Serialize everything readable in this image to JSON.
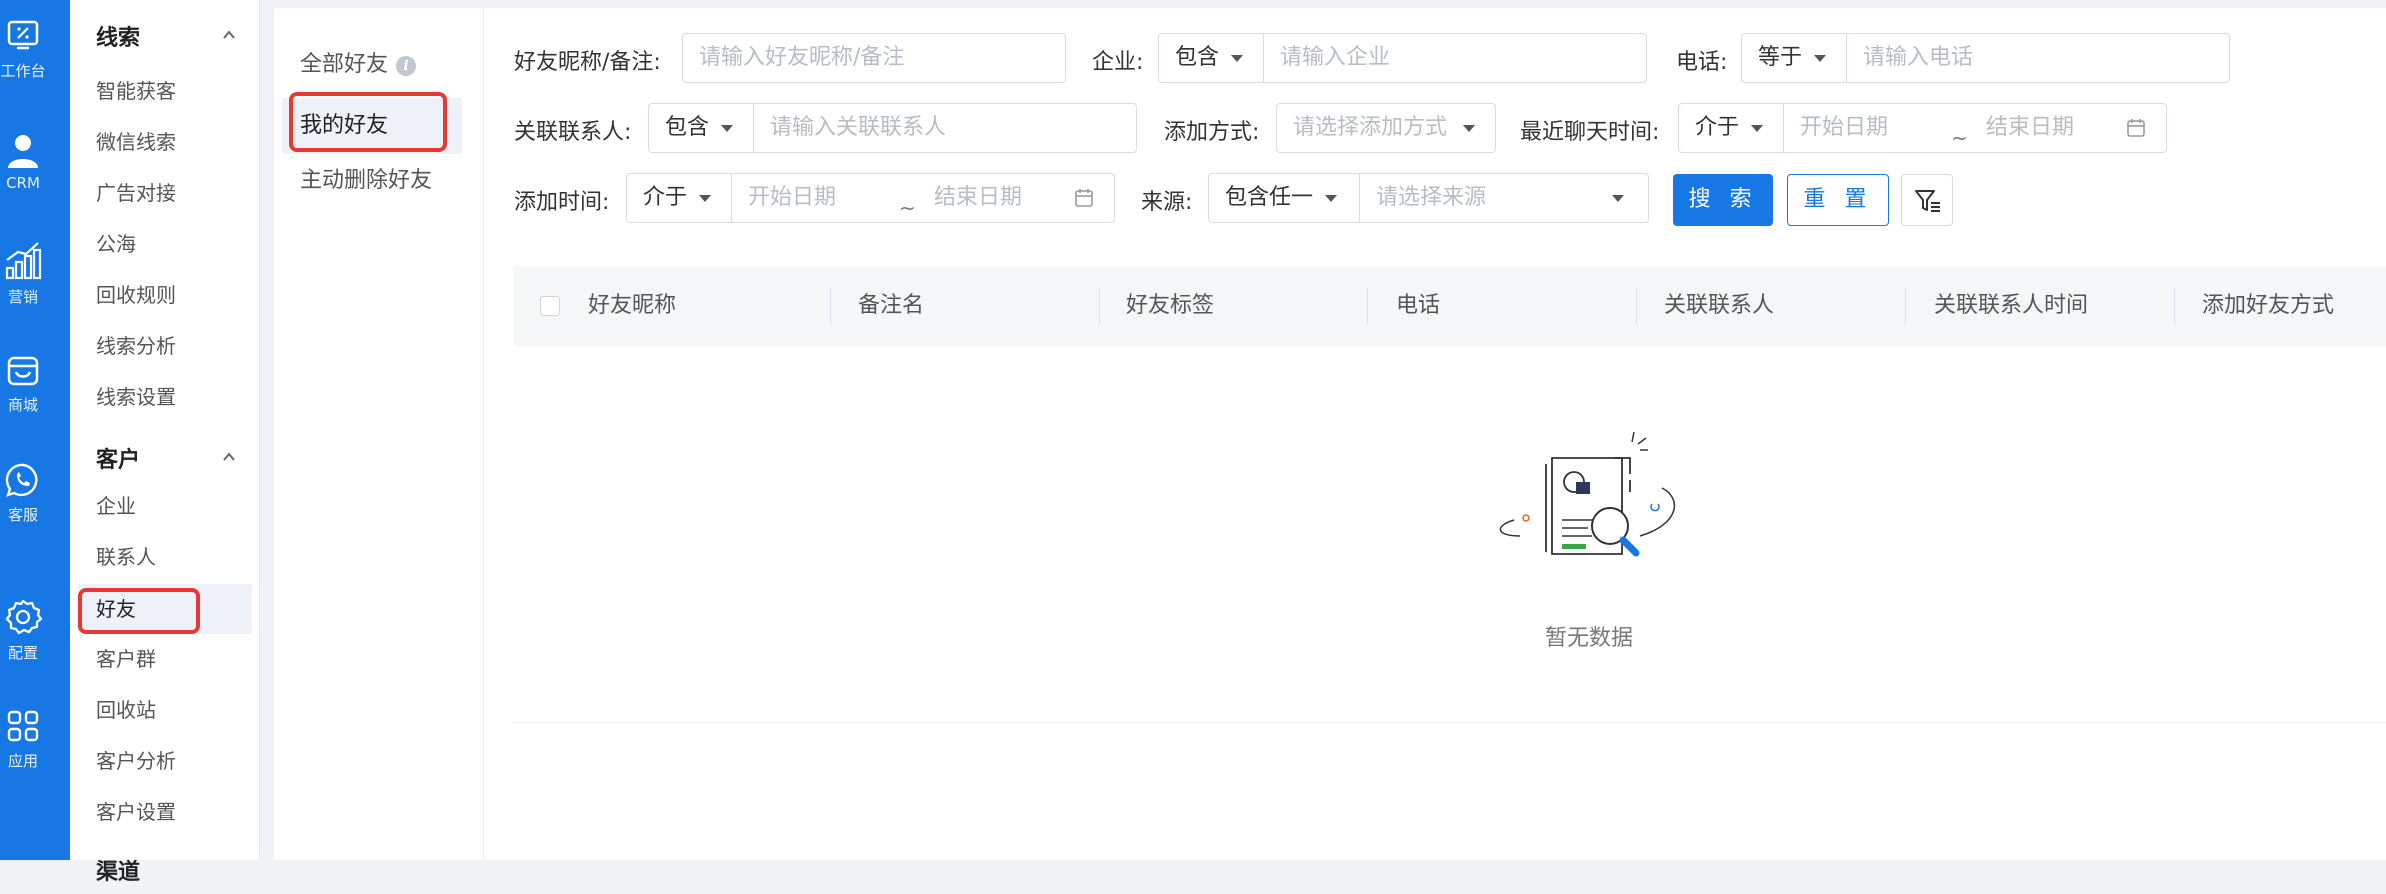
{
  "rail": {
    "items": [
      {
        "label": "工作台",
        "icon": "workbench-icon"
      },
      {
        "label": "CRM",
        "icon": "user-icon"
      },
      {
        "label": "营销",
        "icon": "bar-chart-icon"
      },
      {
        "label": "商城",
        "icon": "store-icon"
      },
      {
        "label": "客服",
        "icon": "whatsapp-icon"
      },
      {
        "label": "配置",
        "icon": "gear-icon"
      },
      {
        "label": "应用",
        "icon": "apps-grid-icon"
      }
    ]
  },
  "menu": {
    "groups": [
      {
        "title": "线索",
        "items": [
          "智能获客",
          "微信线索",
          "广告对接",
          "公海",
          "回收规则",
          "线索分析",
          "线索设置"
        ]
      },
      {
        "title": "客户",
        "items": [
          "企业",
          "联系人",
          "好友",
          "客户群",
          "回收站",
          "客户分析",
          "客户设置"
        ]
      }
    ],
    "active": "好友",
    "next_group_partial": "渠道"
  },
  "categories": {
    "items": [
      "全部好友",
      "我的好友",
      "主动删除好友"
    ],
    "active": "我的好友",
    "info_glyph": "i"
  },
  "filters": {
    "nickname_label": "好友昵称/备注:",
    "nickname_placeholder": "请输入好友昵称/备注",
    "company_label": "企业:",
    "company_op": "包含",
    "company_placeholder": "请输入企业",
    "phone_label": "电话:",
    "phone_op": "等于",
    "phone_placeholder": "请输入电话",
    "contact_label": "关联联系人:",
    "contact_op": "包含",
    "contact_placeholder": "请输入关联联系人",
    "add_method_label": "添加方式:",
    "add_method_placeholder": "请选择添加方式",
    "last_chat_label": "最近聊天时间:",
    "last_chat_op": "介于",
    "start_date": "开始日期",
    "end_date": "结束日期",
    "tilde": "~",
    "add_time_label": "添加时间:",
    "add_time_op": "介于",
    "source_label": "来源:",
    "source_op": "包含任一",
    "source_placeholder": "请选择来源",
    "search_button": "搜 索",
    "reset_button": "重 置"
  },
  "table": {
    "columns": [
      "好友昵称",
      "备注名",
      "好友标签",
      "电话",
      "关联联系人",
      "关联联系人时间",
      "添加好友方式"
    ]
  },
  "empty": {
    "text": "暂无数据"
  },
  "colors": {
    "primary": "#1677e5",
    "annotation": "#e53935"
  }
}
